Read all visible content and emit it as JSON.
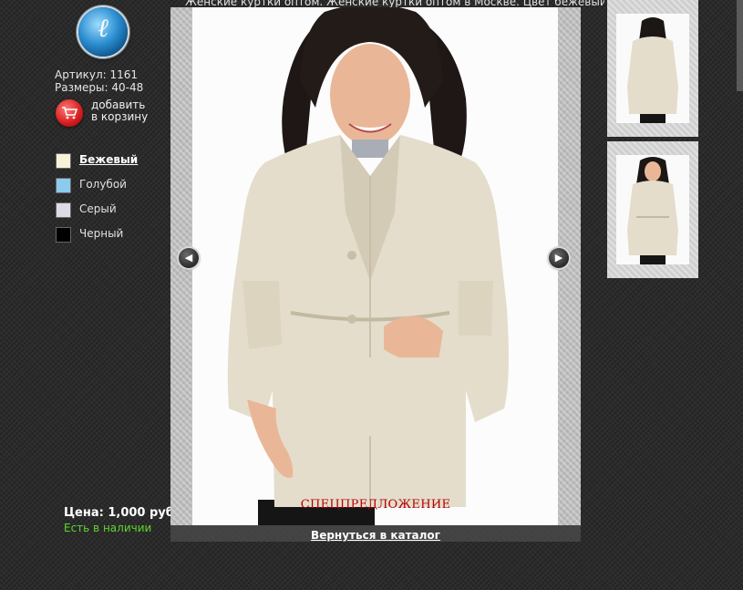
{
  "header": {
    "breadcrumb_text": "Женские куртки оптом. Женские куртки оптом в Москве. Цвет бежевый"
  },
  "product": {
    "article": "Артикул: 1161",
    "sizes": "Размеры: 40-48",
    "add_to_cart_line1": "добавить",
    "add_to_cart_line2": "в корзину",
    "price": "Цена: 1,000 руб.",
    "availability": "Есть в наличии",
    "special_offer": "СПЕЦПРЕДЛОЖЕНИЕ",
    "back_to_catalog": "Вернуться в каталог"
  },
  "colors": [
    {
      "label": "Бежевый",
      "swatch": "#f7f2d8",
      "selected": true
    },
    {
      "label": "Голубой",
      "swatch": "#8ccbee",
      "selected": false
    },
    {
      "label": "Серый",
      "swatch": "#dedbe6",
      "selected": false
    },
    {
      "label": "Черный",
      "swatch": "#000000",
      "selected": false
    }
  ],
  "icons": {
    "logo": "logo-icon",
    "cart": "cart-icon",
    "prev": "arrow-left-icon",
    "next": "arrow-right-icon"
  },
  "palette": {
    "availability_green": "#5cd62e",
    "special_offer_red": "#b30000",
    "coat_beige": "#e4ddcc"
  }
}
